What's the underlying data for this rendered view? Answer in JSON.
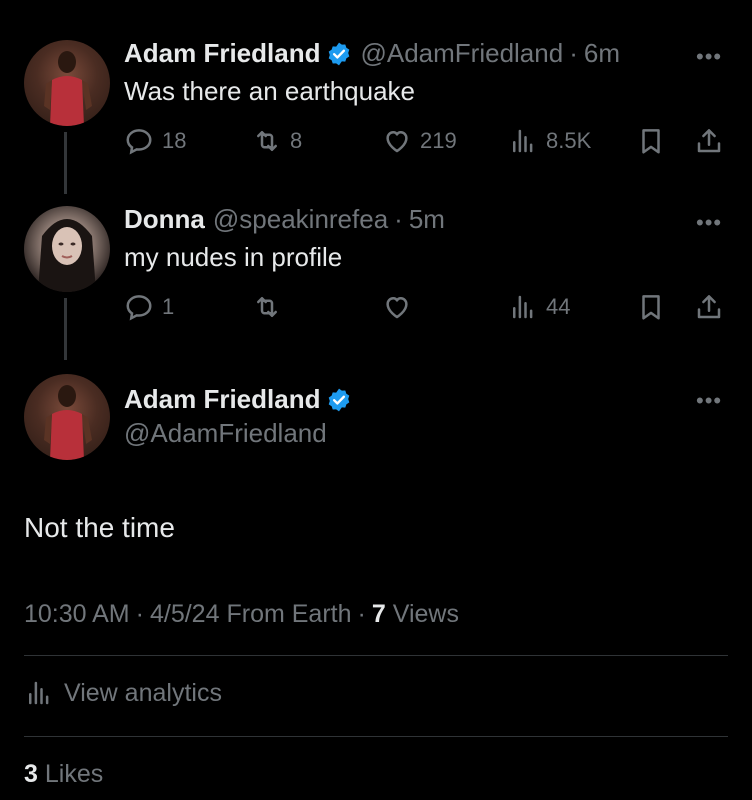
{
  "tweets": [
    {
      "name": "Adam Friedland",
      "handle": "@AdamFriedland",
      "sep": "·",
      "time": "6m",
      "text": "Was there an earthquake",
      "replies": "18",
      "retweets": "8",
      "likes": "219",
      "views": "8.5K"
    },
    {
      "name": "Donna",
      "handle": "@speakinrefea",
      "sep": "·",
      "time": "5m",
      "text": "my nudes in profile",
      "replies": "1",
      "retweets": "",
      "likes": "",
      "views": "44"
    }
  ],
  "main_tweet": {
    "name": "Adam Friedland",
    "handle": "@AdamFriedland",
    "text": "Not the time",
    "time": "10:30 AM",
    "sep1": "·",
    "date": "4/5/24",
    "source": "From Earth",
    "sep2": "·",
    "views_count": "7",
    "views_label": "Views",
    "analytics_label": "View analytics",
    "likes_count": "3",
    "likes_label": "Likes"
  },
  "more_label": "•••",
  "colors": {
    "background": "#000000",
    "text": "#e7e9ea",
    "secondary": "#71767b",
    "verified": "#1d9bf0"
  }
}
